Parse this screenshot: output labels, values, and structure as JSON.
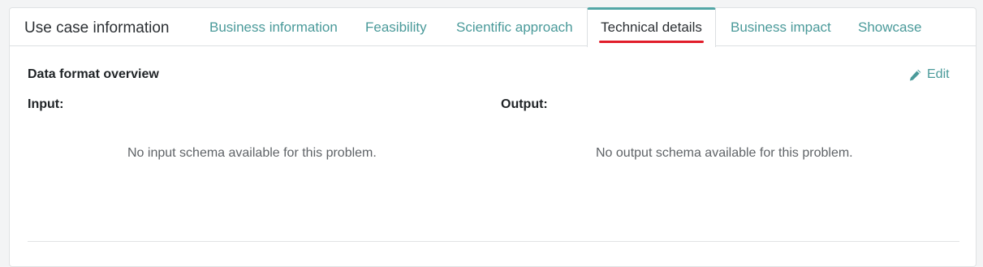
{
  "card": {
    "title": "Use case information"
  },
  "tabs": [
    {
      "label": "Business information",
      "active": false
    },
    {
      "label": "Feasibility",
      "active": false
    },
    {
      "label": "Scientific approach",
      "active": false
    },
    {
      "label": "Technical details",
      "active": true
    },
    {
      "label": "Business impact",
      "active": false
    },
    {
      "label": "Showcase",
      "active": false
    }
  ],
  "section": {
    "title": "Data format overview",
    "edit_label": "Edit",
    "edit_icon": "pencil-icon"
  },
  "input": {
    "label": "Input:",
    "empty_message": "No input schema available for this problem."
  },
  "output": {
    "label": "Output:",
    "empty_message": "No output schema available for this problem."
  },
  "colors": {
    "accent": "#4a9a9a",
    "active_underline": "#e11d2a",
    "text": "#2b2f33"
  }
}
